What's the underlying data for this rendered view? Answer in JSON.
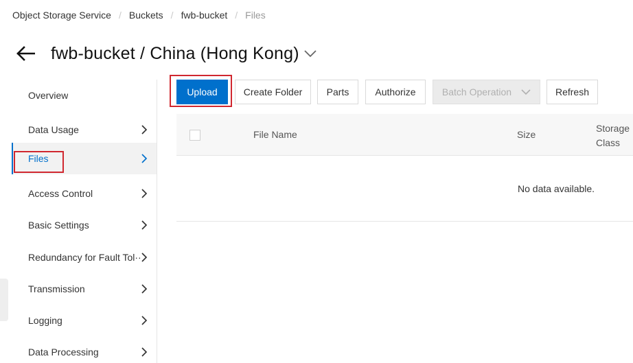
{
  "breadcrumb": {
    "items": [
      "Object Storage Service",
      "Buckets",
      "fwb-bucket",
      "Files"
    ],
    "separator": "/"
  },
  "header": {
    "title": "fwb-bucket / China (Hong Kong)",
    "back_icon": "back-arrow-icon",
    "dropdown_icon": "chevron-down-icon"
  },
  "sidebar": {
    "items": [
      {
        "label": "Overview",
        "has_chevron": false
      },
      {
        "label": "Data Usage",
        "has_chevron": true
      },
      {
        "label": "Files",
        "has_chevron": true,
        "active": true
      },
      {
        "label": "Access Control",
        "has_chevron": true
      },
      {
        "label": "Basic Settings",
        "has_chevron": true
      },
      {
        "label": "Redundancy for Fault Tol···",
        "has_chevron": true
      },
      {
        "label": "Transmission",
        "has_chevron": true
      },
      {
        "label": "Logging",
        "has_chevron": true
      },
      {
        "label": "Data Processing",
        "has_chevron": true
      }
    ]
  },
  "toolbar": {
    "upload": "Upload",
    "create_folder": "Create Folder",
    "parts": "Parts",
    "authorize": "Authorize",
    "batch_operation": "Batch Operation",
    "refresh": "Refresh"
  },
  "table": {
    "columns": [
      "File Name",
      "Size",
      "Storage Class"
    ],
    "empty_text": "No data available."
  },
  "colors": {
    "primary": "#0070cc",
    "highlight": "#d0272f",
    "active_bg": "#f2f2f2"
  }
}
